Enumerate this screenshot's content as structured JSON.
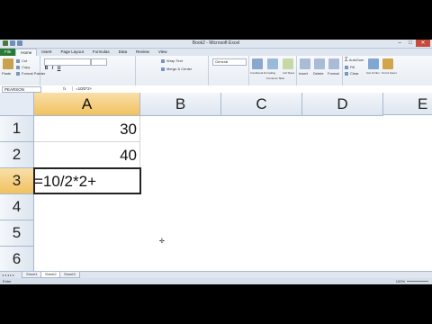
{
  "window": {
    "title": "Book2 - Microsoft Excel",
    "controls": [
      "–",
      "□",
      "✕"
    ]
  },
  "tabs": [
    "File",
    "Home",
    "Insert",
    "Page Layout",
    "Formulas",
    "Data",
    "Review",
    "View"
  ],
  "ribbon": {
    "clipboard": {
      "paste": "Paste",
      "cut": "Cut",
      "copy": "Copy",
      "format_painter": "Format Painter",
      "label": "Clipboard"
    },
    "font": {
      "bold": "B",
      "italic": "I",
      "underline": "U",
      "label": "Font"
    },
    "alignment": {
      "wrap": "Wrap Text",
      "merge": "Merge & Center",
      "label": "Alignment"
    },
    "number": {
      "format": "General",
      "label": "Number"
    },
    "styles": {
      "conditional": "Conditional Formatting",
      "format_table": "Format as Table",
      "cell_styles": "Cell Styles",
      "label": "Styles"
    },
    "cells": {
      "insert": "Insert",
      "delete": "Delete",
      "format": "Format",
      "label": "Cells"
    },
    "editing": {
      "autosum": "AutoSum",
      "fill": "Fill",
      "clear": "Clear",
      "sort": "Sort & Filter",
      "find": "Find & Select",
      "label": "Editing"
    }
  },
  "formula_bar": {
    "name_box": "PEARSON",
    "fx": "fx",
    "formula": "=10/2*2+"
  },
  "columns": [
    "A",
    "B",
    "C",
    "D",
    "E"
  ],
  "rows": [
    "1",
    "2",
    "3",
    "4",
    "5",
    "6"
  ],
  "cells": {
    "A1": "30",
    "A2": "40",
    "A3": "=10/2*2+"
  },
  "sheets": [
    "Sheet1",
    "Sheet2",
    "Sheet3"
  ],
  "active_sheet": "Sheet2",
  "status": {
    "mode": "Enter",
    "zoom": "100%"
  },
  "colors": {
    "file_tab": "#2a7a36",
    "selected_header": "#f1c15f"
  }
}
